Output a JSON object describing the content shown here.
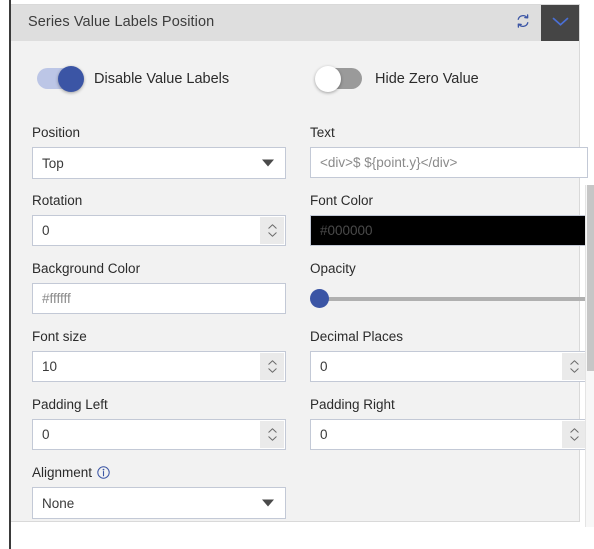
{
  "panel": {
    "title": "Series Value Labels Position",
    "refresh_icon": "refresh-icon",
    "collapse_icon": "chevron-down-icon"
  },
  "toggles": [
    {
      "label": "Disable Value Labels",
      "state": "on"
    },
    {
      "label": "Hide Zero Value",
      "state": "off"
    }
  ],
  "fields": {
    "position": {
      "label": "Position",
      "value": "Top",
      "type": "select"
    },
    "text": {
      "label": "Text",
      "value": "<div>$ ${point.y}</div>",
      "type": "text"
    },
    "rotation": {
      "label": "Rotation",
      "value": "0",
      "type": "number"
    },
    "font_color": {
      "label": "Font Color",
      "value": "#000000",
      "type": "color",
      "swatch": "#000000"
    },
    "background_color": {
      "label": "Background Color",
      "value": "#ffffff",
      "type": "color",
      "swatch": "#ffffff"
    },
    "opacity": {
      "label": "Opacity",
      "value": "0",
      "type": "slider",
      "min": "0",
      "max": "100"
    },
    "font_size": {
      "label": "Font size",
      "value": "10",
      "type": "number"
    },
    "decimal_places": {
      "label": "Decimal Places",
      "value": "0",
      "type": "number"
    },
    "padding_left": {
      "label": "Padding Left",
      "value": "0",
      "type": "number"
    },
    "padding_right": {
      "label": "Padding Right",
      "value": "0",
      "type": "number"
    },
    "alignment": {
      "label": "Alignment",
      "value": "None",
      "type": "select",
      "info_icon": "info-icon"
    }
  },
  "colors": {
    "accent": "#3b55a5",
    "header_bg": "#dedede",
    "panel_bg": "#f2f2f2",
    "collapse_bg": "#454545"
  }
}
